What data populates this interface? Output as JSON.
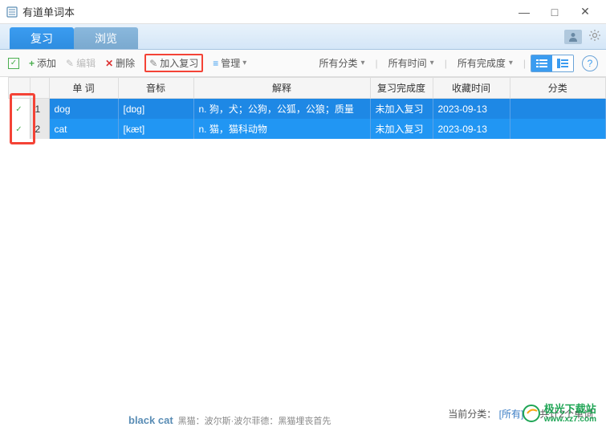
{
  "window": {
    "title": "有道单词本"
  },
  "tabs": {
    "review": "复习",
    "browse": "浏览"
  },
  "toolbar": {
    "add": "添加",
    "edit": "编辑",
    "delete": "删除",
    "add_review": "加入复习",
    "manage": "管理"
  },
  "filters": {
    "category": "所有分类",
    "time": "所有时间",
    "completion": "所有完成度"
  },
  "table": {
    "headers": {
      "word": "单 词",
      "phonetic": "音标",
      "definition": "解释",
      "review_status": "复习完成度",
      "collect_time": "收藏时间",
      "category": "分类"
    },
    "rows": [
      {
        "num": "1",
        "word": "dog",
        "phonetic": "[dɒɡ]",
        "definition": "n. 狗，犬；公狗，公狐，公狼；质量",
        "review_status": "未加入复习",
        "collect_time": "2023-09-13",
        "category": ""
      },
      {
        "num": "2",
        "word": "cat",
        "phonetic": "[kæt]",
        "definition": "n. 猫，猫科动物",
        "review_status": "未加入复习",
        "collect_time": "2023-09-13",
        "category": ""
      }
    ]
  },
  "status": {
    "current_category_label": "当前分类：",
    "current_category_value": "[所有]",
    "count": "共计2个单词"
  },
  "watermark": {
    "text": "极光下载站",
    "url": "www.xz7.com"
  },
  "bottom": {
    "word": "black cat",
    "extra": "黑猫：波尔斯·波尔菲德：黑猫埋丧首先"
  }
}
